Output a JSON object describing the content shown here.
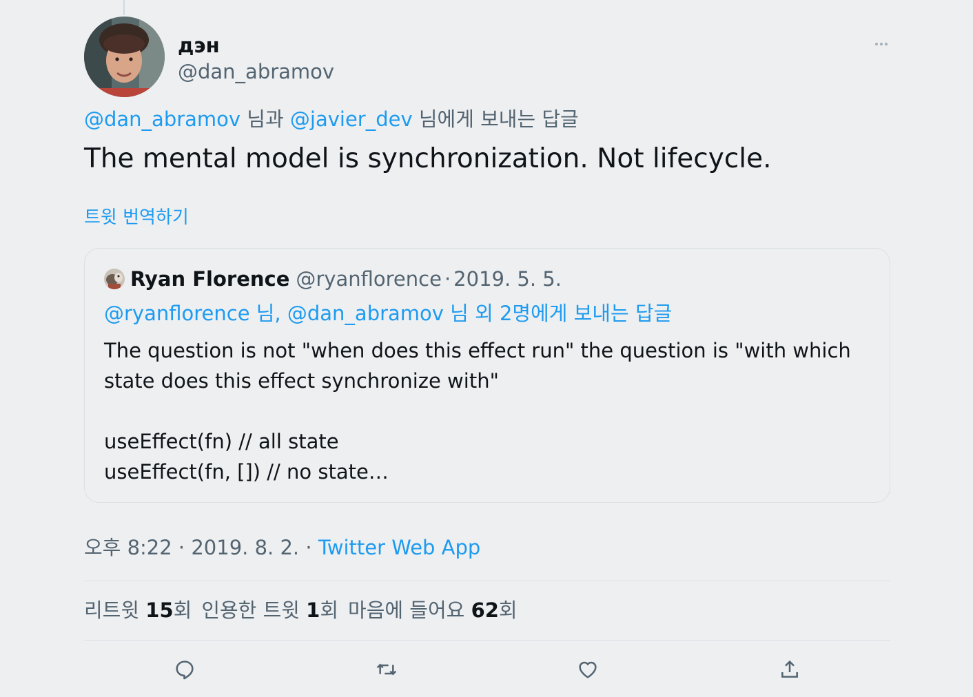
{
  "tweet": {
    "author": {
      "display_name": "дэн",
      "handle": "@dan_abramov"
    },
    "reply_context": {
      "mention_1": "@dan_abramov",
      "connector_1": " 님과 ",
      "mention_2": "@javier_dev",
      "suffix": " 님에게 보내는 답글"
    },
    "text": "The mental model is synchronization. Not lifecycle.",
    "translate_label": "트윗 번역하기",
    "quoted": {
      "display_name": "Ryan Florence",
      "handle": "@ryanflorence",
      "separator": "·",
      "date": "2019. 5. 5.",
      "reply_context": "@ryanflorence 님, @dan_abramov 님 외 2명에게 보내는 답글",
      "body": "The question is not \"when does this effect run\" the question is \"with which state does this effect synchronize with\"\n\nuseEffect(fn) // all state\nuseEffect(fn, []) // no state…"
    },
    "meta": {
      "time": "오후 8:22 · 2019. 8. 2. · ",
      "source": "Twitter Web App"
    },
    "stats": [
      {
        "label": "리트윗 ",
        "count": "15",
        "unit": "회"
      },
      {
        "label": "인용한 트윗 ",
        "count": "1",
        "unit": "회"
      },
      {
        "label": "마음에 들어요 ",
        "count": "62",
        "unit": "회"
      }
    ],
    "actions": [
      "reply-icon",
      "retweet-icon",
      "like-icon",
      "share-icon"
    ]
  },
  "colors": {
    "background": "#eeeff1",
    "link": "#1d9bf0",
    "secondary_text": "#536471",
    "primary_text": "#0f1419",
    "border": "#d9dfe3"
  }
}
